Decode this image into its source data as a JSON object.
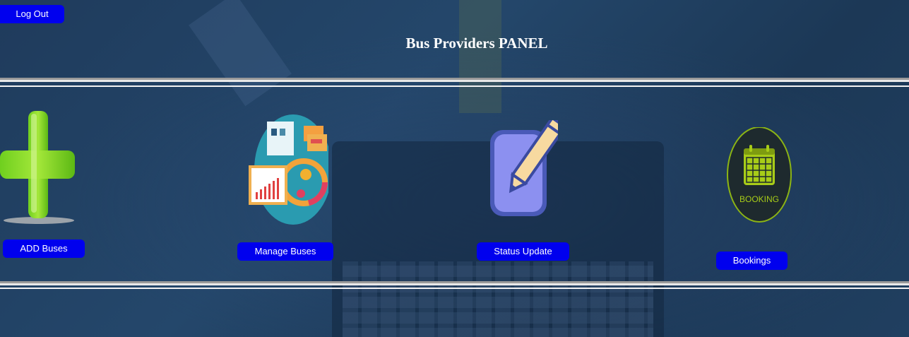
{
  "header": {
    "logout_label": "Log Out",
    "title": "Bus Providers PANEL"
  },
  "tiles": [
    {
      "label": "ADD Buses",
      "icon": "add-plus-icon"
    },
    {
      "label": "Manage Buses",
      "icon": "manage-dashboard-icon"
    },
    {
      "label": "Status Update",
      "icon": "edit-pencil-icon"
    },
    {
      "label": "Bookings",
      "icon": "booking-calendar-icon",
      "icon_text": "BOOKING"
    }
  ],
  "colors": {
    "button_bg": "#0000ee",
    "button_text": "#ffffff",
    "title_text": "#ffffff",
    "background": "#1f3b5c"
  }
}
